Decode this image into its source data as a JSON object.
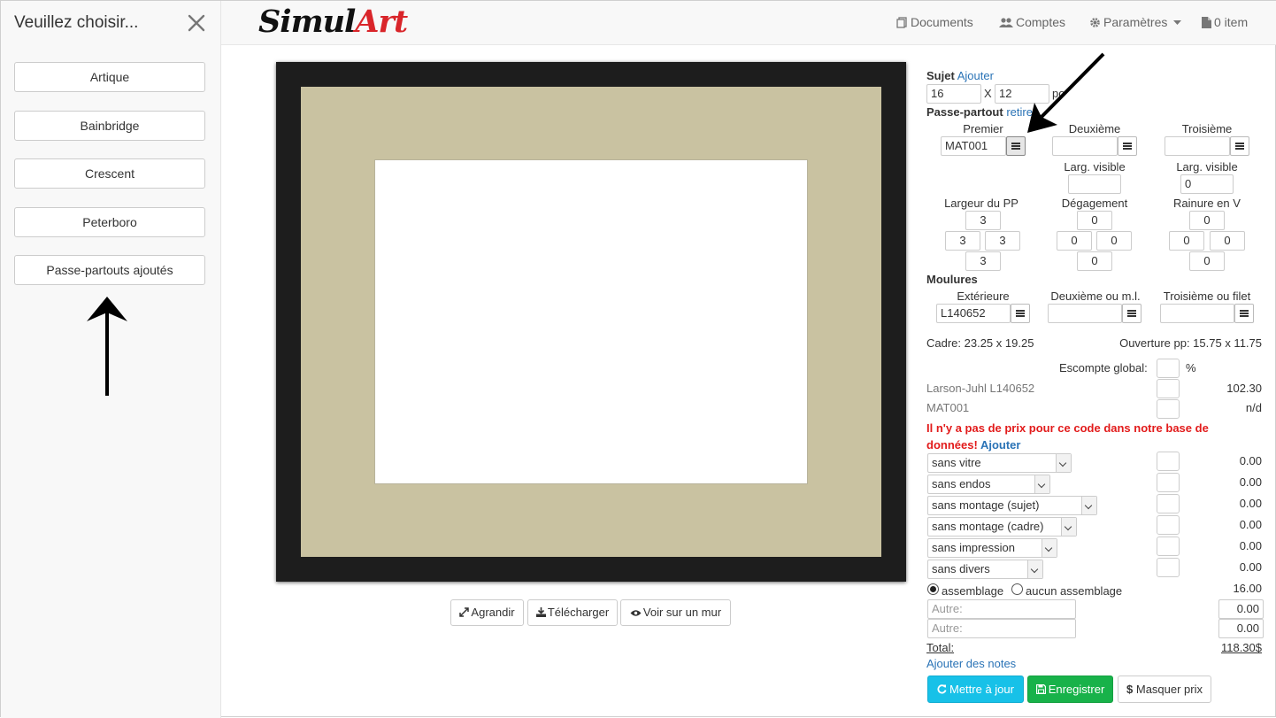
{
  "sidebar": {
    "title": "Veuillez choisir...",
    "items": [
      {
        "label": "Artique"
      },
      {
        "label": "Bainbridge"
      },
      {
        "label": "Crescent"
      },
      {
        "label": "Peterboro"
      },
      {
        "label": "Passe-partouts ajoutés"
      }
    ]
  },
  "navbar": {
    "logo_part1": "Simul",
    "logo_part2": "Art",
    "documents": "Documents",
    "comptes": "Comptes",
    "parametres": "Paramètres",
    "cart": "0 item"
  },
  "preview": {
    "colors": {
      "frame": "#1d1d1d",
      "mat": "#c9c2a1"
    },
    "agrandir": "Agrandir",
    "telecharger": "Télécharger",
    "voir_mur": "Voir sur un mur"
  },
  "sujet": {
    "label": "Sujet",
    "add_link": "Ajouter",
    "width": "16",
    "x": "X",
    "height": "12",
    "unit": "po"
  },
  "passepartout": {
    "label": "Passe-partout",
    "remove_link": "retirer",
    "premier": "Premier",
    "deuxieme": "Deuxième",
    "troisieme": "Troisième",
    "premier_code": "MAT001",
    "deuxieme_code": "",
    "troisieme_code": "",
    "larg_visible": "Larg. visible",
    "larg_visible_2": "",
    "larg_visible_3": "0",
    "largeur_pp": "Largeur du PP",
    "degagement": "Dégagement",
    "rainure_v": "Rainure en V",
    "pp_top": "3",
    "pp_left": "3",
    "pp_right": "3",
    "pp_bottom": "3",
    "deg_top": "0",
    "deg_left": "0",
    "deg_right": "0",
    "deg_bottom": "0",
    "rv_top": "0",
    "rv_left": "0",
    "rv_right": "0",
    "rv_bottom": "0"
  },
  "moulures": {
    "label": "Moulures",
    "exterieure": "Extérieure",
    "deuxieme": "Deuxième ou m.l.",
    "troisieme": "Troisième ou filet",
    "exterieure_code": "L140652",
    "deuxieme_code": "",
    "troisieme_code": ""
  },
  "dims": {
    "cadre": "Cadre: 23.25 x 19.25",
    "ouverture": "Ouverture pp: 15.75 x 11.75"
  },
  "pricing": {
    "escompte_label": "Escompte global:",
    "percent": "%",
    "lines": [
      {
        "label": "Larson-Juhl L140652",
        "price": "102.30"
      },
      {
        "label": "MAT001",
        "price": "n/d"
      }
    ],
    "error_text": "Il n'y a pas de prix pour ce code dans notre base de données!",
    "error_link": "Ajouter",
    "options": [
      {
        "label": "sans vitre",
        "price": "0.00"
      },
      {
        "label": "sans endos",
        "price": "0.00"
      },
      {
        "label": "sans montage (sujet)",
        "price": "0.00"
      },
      {
        "label": "sans montage (cadre)",
        "price": "0.00"
      },
      {
        "label": "sans impression",
        "price": "0.00"
      },
      {
        "label": "sans divers",
        "price": "0.00"
      }
    ],
    "assemblage": "assemblage",
    "aucun_assemblage": "aucun assemblage",
    "assemblage_price": "16.00",
    "autre_placeholder": "Autre:",
    "autre1_value": "0.00",
    "autre2_value": "0.00",
    "total_label": "Total:",
    "total_value": "118.30$",
    "notes_link": "Ajouter des notes"
  },
  "actions": {
    "update": "Mettre à jour",
    "save": "Enregistrer",
    "hide_price": "Masquer prix",
    "colors": {
      "update": "#17c1e8",
      "save": "#18b24a"
    }
  }
}
